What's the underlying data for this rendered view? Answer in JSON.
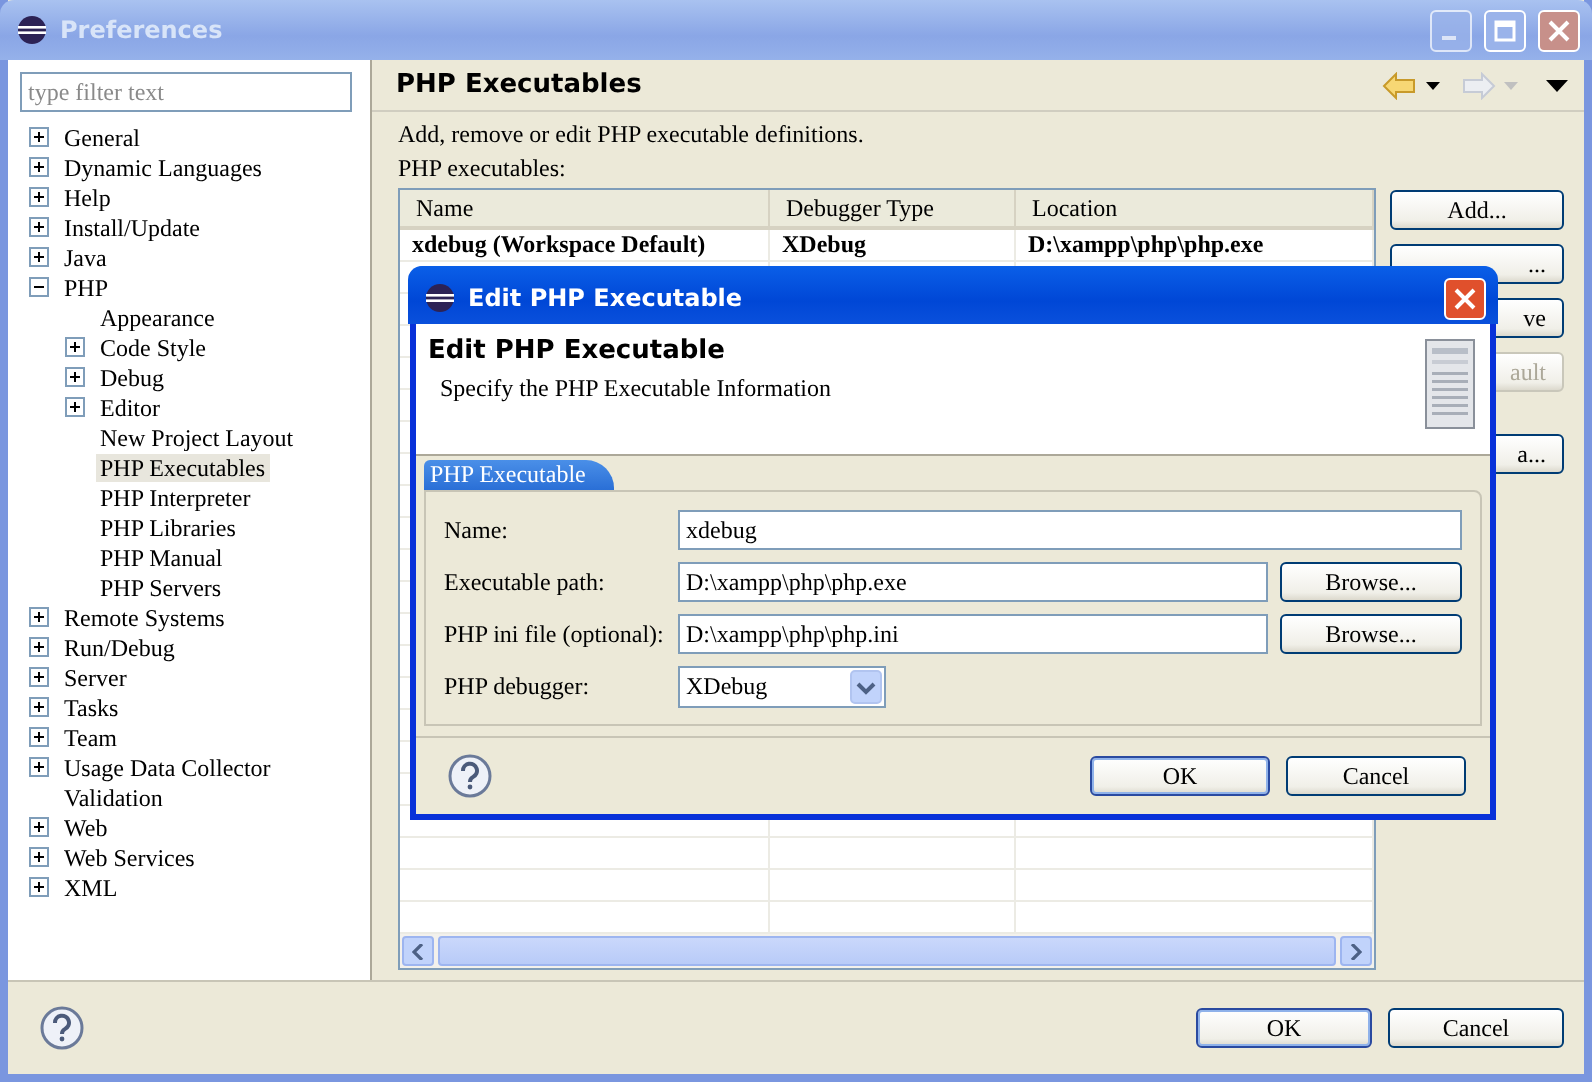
{
  "window": {
    "title": "Preferences",
    "active": false
  },
  "filter": {
    "placeholder": "type filter text"
  },
  "tree": [
    {
      "label": "General",
      "kind": "node",
      "expanded": false,
      "selected": false
    },
    {
      "label": "Dynamic Languages",
      "kind": "node",
      "expanded": false,
      "selected": false
    },
    {
      "label": "Help",
      "kind": "node",
      "expanded": false,
      "selected": false
    },
    {
      "label": "Install/Update",
      "kind": "node",
      "expanded": false,
      "selected": false
    },
    {
      "label": "Java",
      "kind": "node",
      "expanded": false,
      "selected": false
    },
    {
      "label": "PHP",
      "kind": "node",
      "expanded": true,
      "selected": false,
      "children": [
        {
          "label": "Appearance",
          "kind": "leaf",
          "selected": false
        },
        {
          "label": "Code Style",
          "kind": "node",
          "expanded": false,
          "selected": false
        },
        {
          "label": "Debug",
          "kind": "node",
          "expanded": false,
          "selected": false
        },
        {
          "label": "Editor",
          "kind": "node",
          "expanded": false,
          "selected": false
        },
        {
          "label": "New Project Layout",
          "kind": "leaf",
          "selected": false
        },
        {
          "label": "PHP Executables",
          "kind": "leaf",
          "selected": true
        },
        {
          "label": "PHP Interpreter",
          "kind": "leaf",
          "selected": false
        },
        {
          "label": "PHP Libraries",
          "kind": "leaf",
          "selected": false
        },
        {
          "label": "PHP Manual",
          "kind": "leaf",
          "selected": false
        },
        {
          "label": "PHP Servers",
          "kind": "leaf",
          "selected": false
        }
      ]
    },
    {
      "label": "Remote Systems",
      "kind": "node",
      "expanded": false,
      "selected": false
    },
    {
      "label": "Run/Debug",
      "kind": "node",
      "expanded": false,
      "selected": false
    },
    {
      "label": "Server",
      "kind": "node",
      "expanded": false,
      "selected": false
    },
    {
      "label": "Tasks",
      "kind": "node",
      "expanded": false,
      "selected": false
    },
    {
      "label": "Team",
      "kind": "node",
      "expanded": false,
      "selected": false
    },
    {
      "label": "Usage Data Collector",
      "kind": "node",
      "expanded": false,
      "selected": false
    },
    {
      "label": "Validation",
      "kind": "leaf",
      "selected": false
    },
    {
      "label": "Web",
      "kind": "node",
      "expanded": false,
      "selected": false
    },
    {
      "label": "Web Services",
      "kind": "node",
      "expanded": false,
      "selected": false
    },
    {
      "label": "XML",
      "kind": "node",
      "expanded": false,
      "selected": false
    }
  ],
  "page": {
    "title": "PHP Executables",
    "description": "Add, remove or edit PHP executable definitions.",
    "list_label": "PHP executables:"
  },
  "table": {
    "columns": [
      "Name",
      "Debugger Type",
      "Location"
    ],
    "rows": [
      {
        "cells": [
          "xdebug (Workspace Default)",
          "XDebug",
          "D:\\xampp\\php\\php.exe"
        ],
        "default": true
      }
    ]
  },
  "side_buttons": [
    {
      "label": "Add...",
      "disabled": false,
      "covered": false
    },
    {
      "label": "...",
      "disabled": false,
      "covered": true
    },
    {
      "label": "ve",
      "disabled": false,
      "covered": true
    },
    {
      "label": "ault",
      "disabled": true,
      "covered": true
    },
    {
      "label": "a...",
      "disabled": false,
      "covered": true
    }
  ],
  "buttons": [
    {
      "label": "OK",
      "default": true
    },
    {
      "label": "Cancel",
      "default": false
    }
  ],
  "dialog": {
    "title": "Edit PHP Executable",
    "active": true,
    "heading": "Edit PHP Executable",
    "subtitle": "Specify the PHP Executable Information",
    "tab": "PHP Executable",
    "fields": [
      {
        "kind": "text",
        "label": "Name:",
        "value": "xdebug"
      },
      {
        "kind": "browse",
        "label": "Executable path:",
        "value": "D:\\xampp\\php\\php.exe",
        "button": "Browse..."
      },
      {
        "kind": "browse",
        "label": "PHP ini file (optional):",
        "value": "D:\\xampp\\php\\php.ini",
        "button": "Browse..."
      },
      {
        "kind": "select",
        "label": "PHP debugger:",
        "value": "XDebug"
      }
    ],
    "buttons": [
      {
        "label": "OK",
        "default": true
      },
      {
        "label": "Cancel",
        "default": false
      }
    ]
  }
}
